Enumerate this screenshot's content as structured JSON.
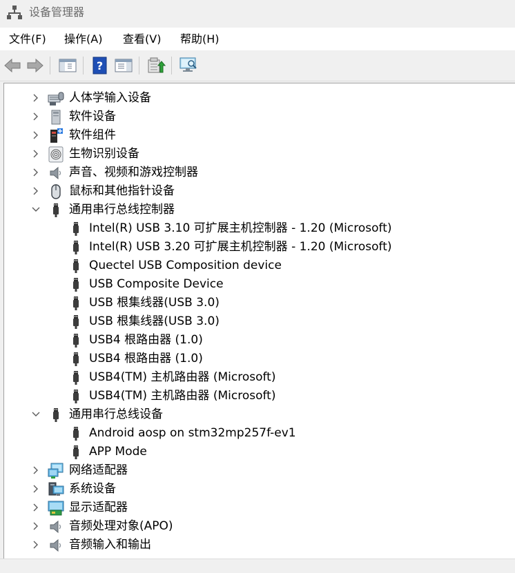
{
  "window": {
    "title": "设备管理器"
  },
  "menubar": {
    "items": [
      {
        "label": "文件(F)"
      },
      {
        "label": "操作(A)"
      },
      {
        "label": "查看(V)"
      },
      {
        "label": "帮助(H)"
      }
    ]
  },
  "toolbar": {
    "buttons": [
      "back-icon",
      "forward-icon",
      "show-hide-console-tree-icon",
      "help-icon",
      "properties-icon",
      "update-driver-icon",
      "scan-hardware-icon"
    ]
  },
  "tree": {
    "nodes": [
      {
        "label": "人体学输入设备",
        "expanded": false,
        "icon": "hid-icon"
      },
      {
        "label": "软件设备",
        "expanded": false,
        "icon": "software-device-icon"
      },
      {
        "label": "软件组件",
        "expanded": false,
        "icon": "software-component-icon"
      },
      {
        "label": "生物识别设备",
        "expanded": false,
        "icon": "fingerprint-icon"
      },
      {
        "label": "声音、视频和游戏控制器",
        "expanded": false,
        "icon": "speaker-icon"
      },
      {
        "label": "鼠标和其他指针设备",
        "expanded": false,
        "icon": "mouse-icon"
      },
      {
        "label": "通用串行总线控制器",
        "expanded": true,
        "icon": "usb-icon",
        "children": [
          "Intel(R) USB 3.10 可扩展主机控制器 - 1.20 (Microsoft)",
          "Intel(R) USB 3.20 可扩展主机控制器 - 1.20 (Microsoft)",
          "Quectel USB Composition device",
          "USB Composite Device",
          "USB 根集线器(USB 3.0)",
          "USB 根集线器(USB 3.0)",
          "USB4 根路由器 (1.0)",
          "USB4 根路由器 (1.0)",
          "USB4(TM) 主机路由器 (Microsoft)",
          "USB4(TM) 主机路由器 (Microsoft)"
        ]
      },
      {
        "label": "通用串行总线设备",
        "expanded": true,
        "icon": "usb-icon",
        "children": [
          "Android aosp on stm32mp257f-ev1",
          "APP Mode"
        ]
      },
      {
        "label": "网络适配器",
        "expanded": false,
        "icon": "network-adapter-icon"
      },
      {
        "label": "系统设备",
        "expanded": false,
        "icon": "system-device-icon"
      },
      {
        "label": "显示适配器",
        "expanded": false,
        "icon": "display-adapter-icon"
      },
      {
        "label": "音频处理对象(APO)",
        "expanded": false,
        "icon": "speaker-icon"
      },
      {
        "label": "音频输入和输出",
        "expanded": false,
        "icon": "speaker-icon"
      }
    ]
  }
}
